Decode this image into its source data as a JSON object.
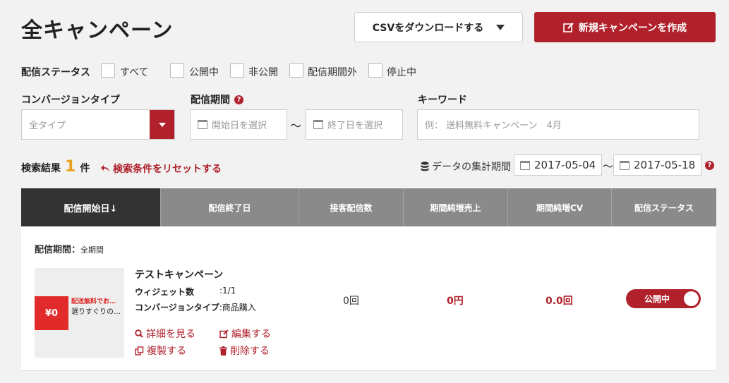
{
  "page_title": "全キャンペーン",
  "toolbar": {
    "csv_label": "CSVをダウンロードする",
    "new_label": "新規キャンペーンを作成"
  },
  "filters": {
    "status_label": "配信ステータス",
    "status_options": [
      "すべて",
      "公開中",
      "非公開",
      "配信期間外",
      "停止中"
    ],
    "conversion_label": "コンバージョンタイプ",
    "conversion_value": "全タイプ",
    "period_label": "配信期間",
    "period_start_placeholder": "開始日を選択",
    "period_separator": "〜",
    "period_end_placeholder": "終了日を選択",
    "keyword_label": "キーワード",
    "keyword_placeholder": "例： 送料無料キャンペーン　4月"
  },
  "results": {
    "label": "検索結果",
    "count": "1",
    "unit": "件",
    "reset_label": "検索条件をリセットする",
    "agg_label": "データの集計期間",
    "agg_start": "2017-05-04",
    "agg_sep": "〜",
    "agg_end": "2017-05-18"
  },
  "table": {
    "headers": [
      "配信開始日↓",
      "配信終了日",
      "接客配信数",
      "期間純増売上",
      "期間純増CV",
      "配信ステータス"
    ],
    "period_prefix": "配信期間：",
    "period_value": "全期間",
    "row": {
      "thumb_icon_text": "¥0",
      "thumb_line1": "配送無料でお…",
      "thumb_line2": "選りすぐりの…",
      "name": "テストキャンペーン",
      "widget_label": "ウィジェット数",
      "widget_value": ":1/1",
      "conv_label": "コンバージョンタイプ",
      "conv_value": ":商品購入",
      "deliveries": "0回",
      "sales": "0円",
      "cv": "0.0回",
      "status": "公開中",
      "actions": {
        "detail": "詳細を見る",
        "edit": "編集する",
        "copy": "複製する",
        "delete": "削除する"
      }
    }
  },
  "colors": {
    "accent": "#b0212c",
    "header_active": "#333333",
    "header": "#8a8a8a",
    "count": "#e8a020"
  }
}
